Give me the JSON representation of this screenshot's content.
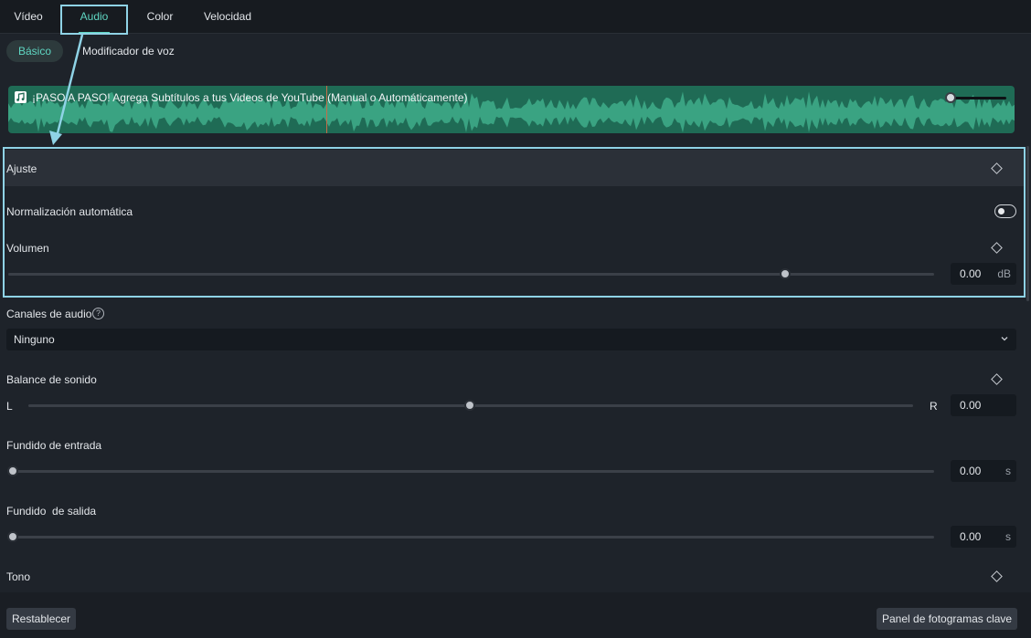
{
  "tabs": [
    {
      "label": "Vídeo"
    },
    {
      "label": "Audio"
    },
    {
      "label": "Color"
    },
    {
      "label": "Velocidad"
    }
  ],
  "active_tab": "Audio",
  "subtabs": [
    {
      "label": "Básico"
    },
    {
      "label": "Modificador de voz"
    }
  ],
  "clip": {
    "title": "¡PASO A PASO! Agrega Subtítulos a tus Videos de YouTube (Manual o Automáticamente)",
    "icon": "music-note-icon",
    "wave_color": "#1f6b55"
  },
  "adjust": {
    "header": "Ajuste",
    "auto_normalization_label": "Normalización automática",
    "auto_normalization_on": false,
    "volume_label": "Volumen",
    "volume_value": "0.00",
    "volume_unit": "dB",
    "volume_level": 0.84
  },
  "channels": {
    "label": "Canales de audio",
    "selected": "Ninguno"
  },
  "balance": {
    "label": "Balance de sonido",
    "left": "L",
    "right": "R",
    "value": "0.00",
    "level": 0.5
  },
  "fade_in": {
    "label": "Fundido de entrada",
    "value": "0.00",
    "unit": "s",
    "level": 0
  },
  "fade_out": {
    "label": "Fundido  de salida",
    "value": "0.00",
    "unit": "s",
    "level": 0
  },
  "pitch": {
    "label": "Tono"
  },
  "footer": {
    "reset_label": "Restablecer",
    "keyframes_label": "Panel de fotogramas clave"
  },
  "colors": {
    "accent": "#5fd6c2",
    "annotation": "#8fd3e6"
  }
}
